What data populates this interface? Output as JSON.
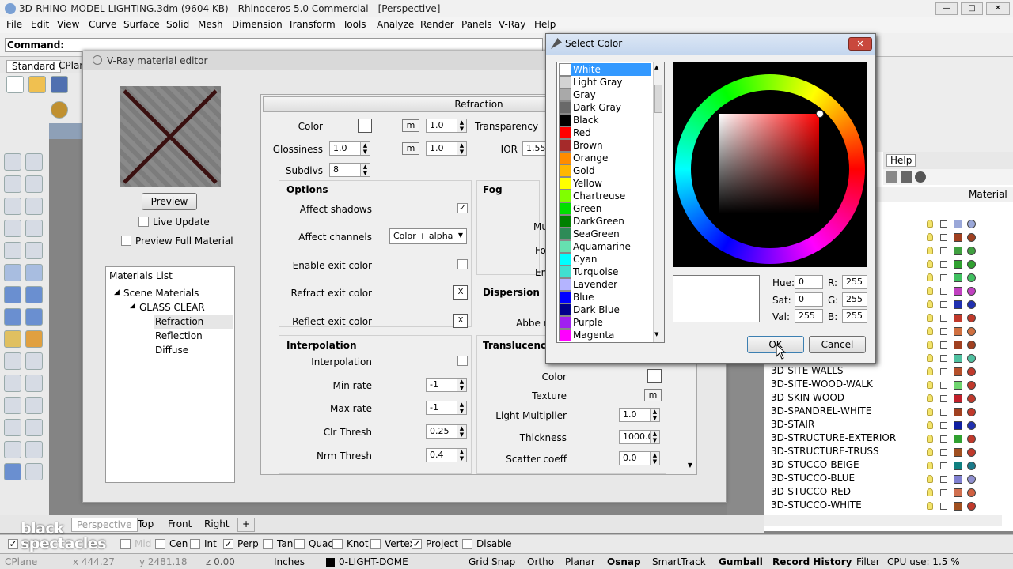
{
  "window": {
    "title": "3D-RHINO-MODEL-LIGHTING.3dm (9604 KB) - Rhinoceros 5.0 Commercial - [Perspective]"
  },
  "menu": [
    "File",
    "Edit",
    "View",
    "Curve",
    "Surface",
    "Solid",
    "Mesh",
    "Dimension",
    "Transform",
    "Tools",
    "Analyze",
    "Render",
    "Panels",
    "V-Ray",
    "Help"
  ],
  "command": {
    "label": "Command:"
  },
  "toolbar_tabs": [
    "Standard",
    "CPlan"
  ],
  "vray_editor": {
    "title": "V-Ray material editor",
    "preview_btn": "Preview",
    "live_update": "Live Update",
    "preview_full": "Preview Full Material",
    "materials_list": {
      "header": "Materials List",
      "scene": "Scene Materials",
      "glass": "GLASS CLEAR",
      "children": [
        "Refraction",
        "Reflection",
        "Diffuse"
      ]
    },
    "refraction": {
      "header": "Refraction",
      "color_label": "Color",
      "m": "m",
      "color_value": "1.0",
      "transparency_label": "Transparency",
      "gloss_label": "Glossiness",
      "gloss_value": "1.0",
      "gloss_value2": "1.0",
      "ior_label": "IOR",
      "ior_value": "1.55",
      "subdivs_label": "Subdivs",
      "subdivs_value": "8"
    },
    "options": {
      "header": "Options",
      "affect_shadows": "Affect shadows",
      "affect_channels": "Affect channels",
      "channels_value": "Color + alpha",
      "enable_exit": "Enable exit color",
      "refract_exit": "Refract exit color",
      "reflect_exit": "Reflect exit color",
      "x": "X"
    },
    "fog": {
      "header": "Fog",
      "mu": "Mu",
      "fo": "Fo",
      "em": "Em"
    },
    "dispersion": {
      "header": "Dispersion",
      "abbe": "Abbe nu"
    },
    "interpolation": {
      "header": "Interpolation",
      "interp": "Interpolation",
      "min_rate": "Min rate",
      "min_rate_v": "-1",
      "max_rate": "Max rate",
      "max_rate_v": "-1",
      "clr_thresh": "Clr Thresh",
      "clr_thresh_v": "0.25",
      "nrm_thresh": "Nrm Thresh",
      "nrm_thresh_v": "0.4"
    },
    "translucency": {
      "header": "Translucency",
      "color": "Color",
      "texture": "Texture",
      "light_mult": "Light Multiplier",
      "light_mult_v": "1.0",
      "thickness": "Thickness",
      "thickness_v": "1000.0",
      "scatter": "Scatter coeff",
      "scatter_v": "0.0"
    }
  },
  "select_color": {
    "title": "Select Color",
    "colors": [
      {
        "name": "White",
        "hex": "#ffffff"
      },
      {
        "name": "Light Gray",
        "hex": "#d3d3d3"
      },
      {
        "name": "Gray",
        "hex": "#a9a9a9"
      },
      {
        "name": "Dark Gray",
        "hex": "#696969"
      },
      {
        "name": "Black",
        "hex": "#000000"
      },
      {
        "name": "Red",
        "hex": "#ff0000"
      },
      {
        "name": "Brown",
        "hex": "#a52a2a"
      },
      {
        "name": "Orange",
        "hex": "#ff8c00"
      },
      {
        "name": "Gold",
        "hex": "#ffb700"
      },
      {
        "name": "Yellow",
        "hex": "#ffff00"
      },
      {
        "name": "Chartreuse",
        "hex": "#80ff00"
      },
      {
        "name": "Green",
        "hex": "#00e000"
      },
      {
        "name": "DarkGreen",
        "hex": "#008000"
      },
      {
        "name": "SeaGreen",
        "hex": "#2e8b57"
      },
      {
        "name": "Aquamarine",
        "hex": "#66e0b0"
      },
      {
        "name": "Cyan",
        "hex": "#00ffff"
      },
      {
        "name": "Turquoise",
        "hex": "#40e0d0"
      },
      {
        "name": "Lavender",
        "hex": "#b4b4ff"
      },
      {
        "name": "Blue",
        "hex": "#0000ff"
      },
      {
        "name": "Dark Blue",
        "hex": "#00008b"
      },
      {
        "name": "Purple",
        "hex": "#a020f0"
      },
      {
        "name": "Magenta",
        "hex": "#ff00ff"
      }
    ],
    "hue_label": "Hue:",
    "hue": "0",
    "sat_label": "Sat:",
    "sat": "0",
    "val_label": "Val:",
    "val": "255",
    "r_label": "R:",
    "r": "255",
    "g_label": "G:",
    "g": "255",
    "b_label": "B:",
    "b": "255",
    "ok": "OK",
    "cancel": "Cancel"
  },
  "right_panel": {
    "help_tab": "Help",
    "material_col": "Material",
    "layers": [
      {
        "name": "3D-SITE-WALLS",
        "sq": "#b5502a",
        "c": "#c0392b"
      },
      {
        "name": "3D-SITE-WOOD-WALK",
        "sq": "#6fd56f",
        "c": "#c0392b"
      },
      {
        "name": "3D-SKIN-WOOD",
        "sq": "#c0202a",
        "c": "#c0392b"
      },
      {
        "name": "3D-SPANDREL-WHITE",
        "sq": "#a04020",
        "c": "#c0392b"
      },
      {
        "name": "3D-STAIR",
        "sq": "#1020a0",
        "c": "#2030b0"
      },
      {
        "name": "3D-STRUCTURE-EXTERIOR",
        "sq": "#30a030",
        "c": "#c0392b"
      },
      {
        "name": "3D-STRUCTURE-TRUSS",
        "sq": "#a05020",
        "c": "#c0392b"
      },
      {
        "name": "3D-STUCCO-BEIGE",
        "sq": "#108080",
        "c": "#1a7a8a"
      },
      {
        "name": "3D-STUCCO-BLUE",
        "sq": "#8080d0",
        "c": "#9090d0"
      },
      {
        "name": "3D-STUCCO-RED",
        "sq": "#d07050",
        "c": "#d06040"
      },
      {
        "name": "3D-STUCCO-WHITE",
        "sq": "#a05020",
        "c": "#c0392b"
      }
    ]
  },
  "viewport_tabs": [
    "Perspective",
    "Top",
    "Front",
    "Right"
  ],
  "osnap": [
    {
      "label": "End",
      "checked": true
    },
    {
      "label": "Mid",
      "checked": false
    },
    {
      "label": "Cen",
      "checked": false
    },
    {
      "label": "Int",
      "checked": false
    },
    {
      "label": "Perp",
      "checked": true
    },
    {
      "label": "Tan",
      "checked": false
    },
    {
      "label": "Quad",
      "checked": false
    },
    {
      "label": "Knot",
      "checked": false
    },
    {
      "label": "Vertex",
      "checked": false
    },
    {
      "label": "Project",
      "checked": true
    },
    {
      "label": "Disable",
      "checked": false
    }
  ],
  "status": {
    "cplane": "CPlane",
    "x": "x 444.27",
    "y": "y 2481.18",
    "z": "z 0.00",
    "units": "Inches",
    "layer": "0-LIGHT-DOME",
    "grid_snap": "Grid Snap",
    "ortho": "Ortho",
    "planar": "Planar",
    "osnap": "Osnap",
    "smarttrack": "SmartTrack",
    "gumball": "Gumball",
    "record": "Record History",
    "filter": "Filter",
    "cpu": "CPU use: 1.5 %"
  },
  "watermark": "black spectacles"
}
